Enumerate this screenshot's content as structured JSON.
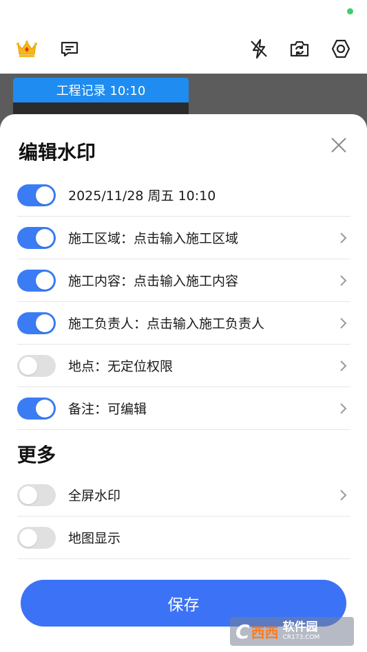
{
  "toolbar": {
    "icons": [
      "crown-icon",
      "message-icon",
      "flash-off-icon",
      "camera-switch-icon",
      "settings-icon"
    ]
  },
  "preview": {
    "watermark_card_title": "工程记录 10:10"
  },
  "sheet": {
    "title": "编辑水印",
    "rows": [
      {
        "label": "2025/11/28 周五 10:10",
        "enabled": true,
        "has_chevron": false
      },
      {
        "label": "施工区域：点击输入施工区域",
        "enabled": true,
        "has_chevron": true
      },
      {
        "label": "施工内容：点击输入施工内容",
        "enabled": true,
        "has_chevron": true
      },
      {
        "label": "施工负责人：点击输入施工负责人",
        "enabled": true,
        "has_chevron": true
      },
      {
        "label": "地点：无定位权限",
        "enabled": false,
        "has_chevron": true
      },
      {
        "label": "备注：可编辑",
        "enabled": true,
        "has_chevron": true
      }
    ],
    "more_title": "更多",
    "more_rows": [
      {
        "label": "全屏水印",
        "enabled": false,
        "has_chevron": true
      },
      {
        "label": "地图显示",
        "enabled": false,
        "has_chevron": false
      }
    ],
    "save_label": "保存"
  },
  "logo": {
    "c": "C",
    "xx": "西西",
    "r1": "软件园",
    "r2": "CR173.COM"
  },
  "colors": {
    "accent": "#3b72f6",
    "toggle_on": "#3b7cf5",
    "toggle_off": "#e0e0e0",
    "card_head": "#1e8cf0",
    "status_dot": "#3ecf6e"
  }
}
